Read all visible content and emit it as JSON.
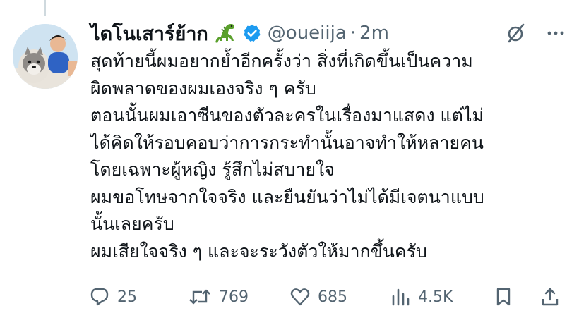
{
  "tweet": {
    "display_name": "ไดโนเสาร์ย้าก",
    "handle": "@oueiija",
    "separator": "·",
    "time": "2m",
    "lines": [
      "สุดท้ายนี้ผมอยากย้ำอีกครั้งว่า สิ่งที่เกิดขึ้นเป็นความ",
      "ผิดพลาดของผมเองจริง ๆ ครับ",
      "ตอนนั้นผมเอาซีนของตัวละครในเรื่องมาแสดง แต่ไม่",
      "ได้คิดให้รอบคอบว่าการกระทำนั้นอาจทำให้หลายคน",
      "โดยเฉพาะผู้หญิง รู้สึกไม่สบายใจ",
      "ผมขอโทษจากใจจริง และยืนยันว่าไม่ได้มีเจตนาแบบ",
      "นั้นเลยครับ",
      "ผมเสียใจจริง ๆ และจะระวังตัวให้มากขึ้นครับ"
    ],
    "stats": {
      "replies": "25",
      "reposts": "769",
      "likes": "685",
      "views": "4.5K"
    }
  },
  "icons": {
    "name_emoji": "dinosaur-emoji",
    "verified": "verified-badge-icon",
    "grok": "grok-icon",
    "more": "more-icon",
    "reply": "reply-icon",
    "repost": "repost-icon",
    "like": "like-icon",
    "views": "views-icon",
    "bookmark": "bookmark-icon",
    "share": "share-icon"
  },
  "colors": {
    "text": "#0f1419",
    "secondary": "#536471",
    "verified": "#1d9bf0",
    "dinosaur": "#5aa02c"
  }
}
